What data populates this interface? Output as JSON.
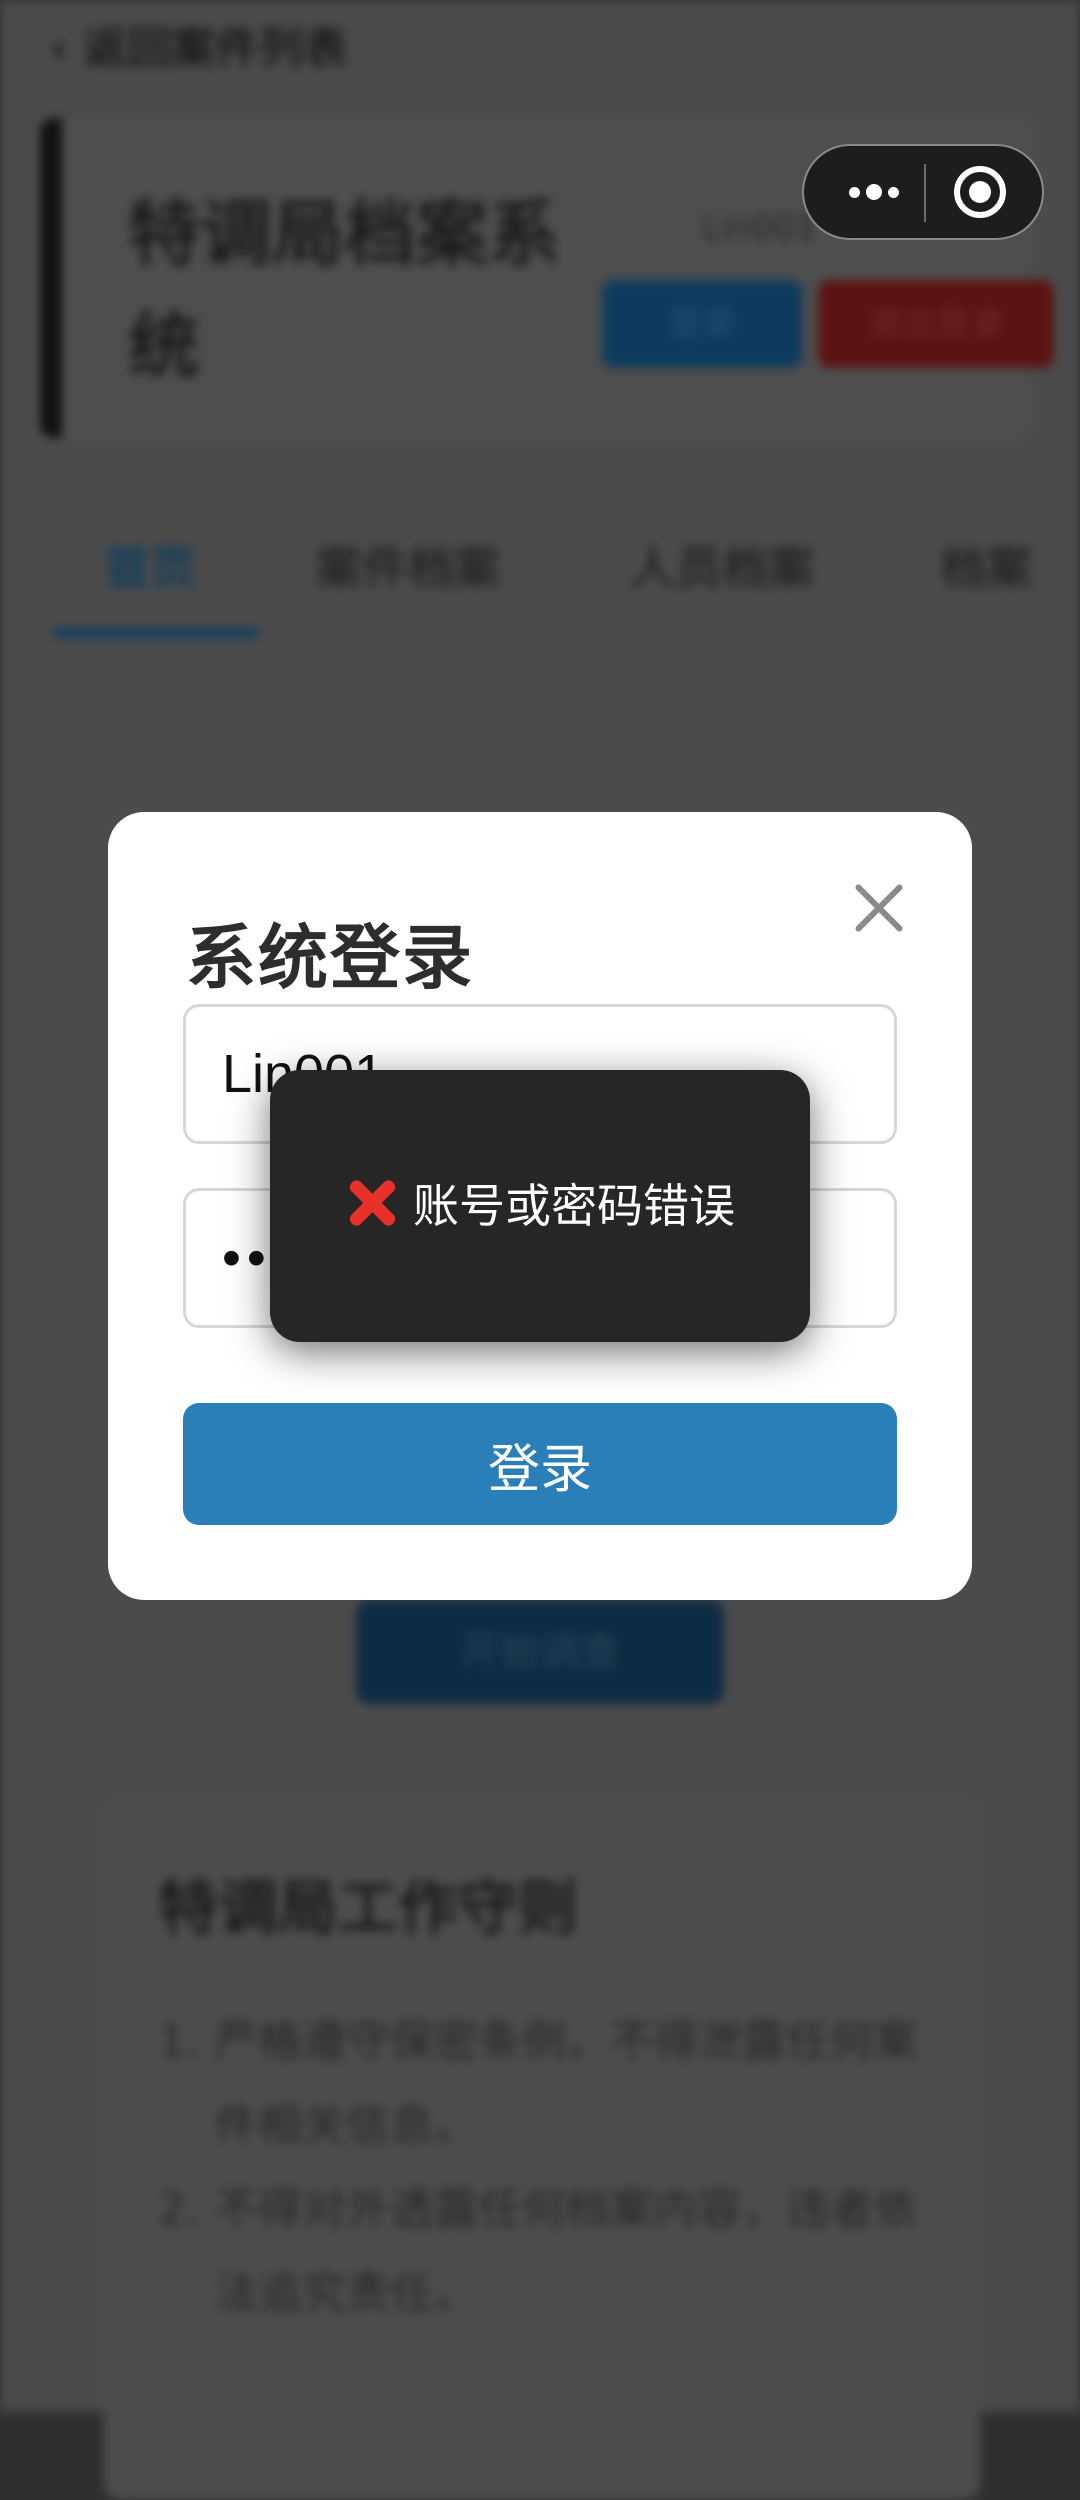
{
  "background": {
    "back_link": "‹ 返回案件列表",
    "app_title": "特调局档案系统",
    "user_text": "Lin001",
    "login_button": "登录",
    "logout_button": "退出登录",
    "tabs": [
      "首页",
      "案件档案",
      "人员档案",
      "档案"
    ],
    "start_button": "开始调查",
    "notice_title": "特调局工作守则",
    "notice_items": [
      "严格遵守保密条例，不得泄露任何案件相关信息。",
      "不得对外透露任何档案内容，违者依法追究责任。"
    ]
  },
  "login_modal": {
    "title": "系统登录",
    "username_value": "Lin001",
    "password_value": "•••••••••",
    "submit_label": "登录"
  },
  "toast": {
    "icon": "cross-mark-icon",
    "message": "账号或密码错误"
  },
  "colors": {
    "primary": "#2b7fb8",
    "error": "#e8312b",
    "toast_bg": "#262626"
  }
}
